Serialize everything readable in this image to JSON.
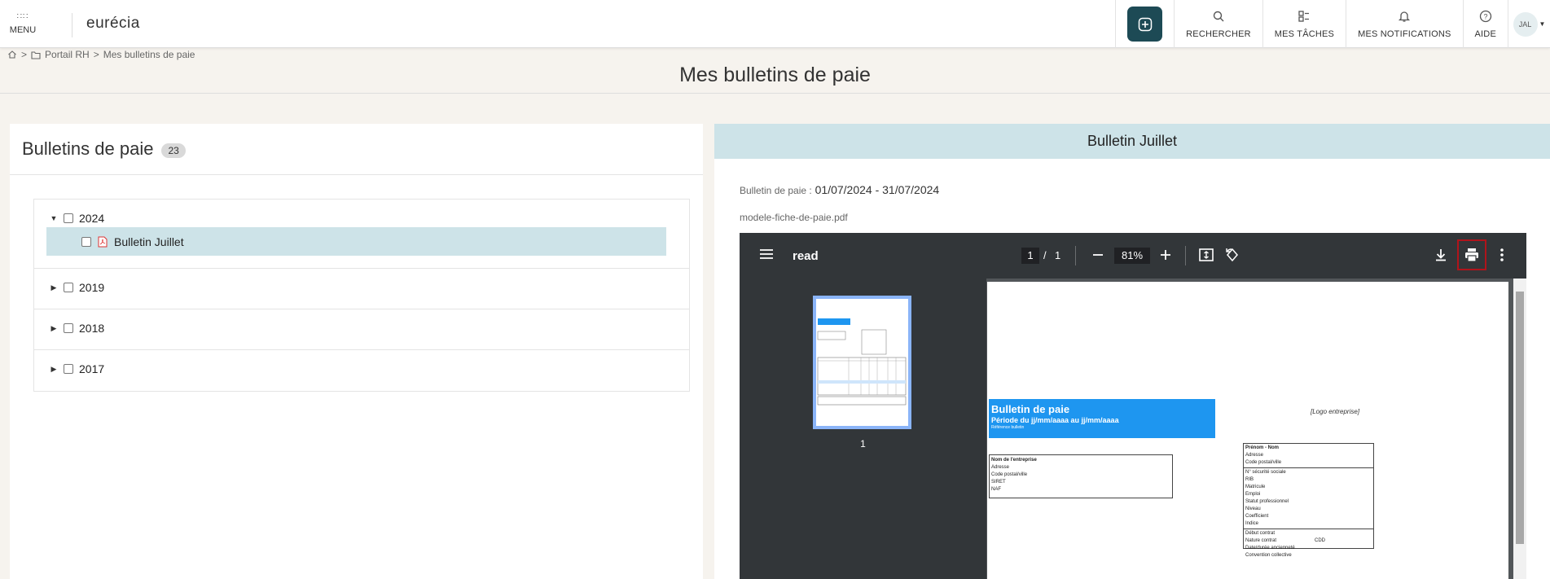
{
  "topbar": {
    "menu_label": "MENU",
    "brand": "eurécia",
    "nav": [
      {
        "label": "RECHERCHER",
        "icon": "search-icon"
      },
      {
        "label": "MES TÂCHES",
        "icon": "tasks-icon"
      },
      {
        "label": "MES NOTIFICATIONS",
        "icon": "bell-icon"
      },
      {
        "label": "AIDE",
        "icon": "help-icon"
      }
    ],
    "avatar": "JAL"
  },
  "breadcrumb": {
    "sep1": ">",
    "portal": "Portail RH",
    "sep2": ">",
    "current": "Mes bulletins de paie"
  },
  "page_title": "Mes bulletins de paie",
  "left": {
    "title": "Bulletins de paie",
    "count": "23",
    "years": [
      {
        "label": "2024",
        "expanded": true,
        "items": [
          "Bulletin Juillet"
        ]
      },
      {
        "label": "2019",
        "expanded": false
      },
      {
        "label": "2018",
        "expanded": false
      },
      {
        "label": "2017",
        "expanded": false
      }
    ]
  },
  "right": {
    "title": "Bulletin Juillet",
    "period_key": "Bulletin de paie :",
    "period_value": "01/07/2024 - 31/07/2024",
    "file_name": "modele-fiche-de-paie.pdf"
  },
  "pdf": {
    "title": "read",
    "page_current": "1",
    "page_sep": "/",
    "page_total": "1",
    "zoom": "81%",
    "thumb_label": "1",
    "doc": {
      "banner_title": "Bulletin de paie",
      "banner_sub": "Période du jj/mm/aaaa au jj/mm/aaaa",
      "banner_ref": "Référence bulletin",
      "logo": "[Logo entreprise]",
      "ent_header": "Nom de l'entreprise",
      "ent_lines": [
        "Adresse",
        "Code postal/ville",
        "SIRET",
        "NAF"
      ],
      "emp_header": "Prénom - Nom",
      "emp_lines1": [
        "Adresse",
        "Code postal/ville"
      ],
      "emp_lines2": [
        "N° sécurité sociale",
        "RIB",
        "Matricule",
        "Emploi",
        "Statut professionnel",
        "Niveau",
        "Coefficient",
        "Indice"
      ],
      "emp_lines3": [
        "Début contrat",
        "Nature contrat",
        "Date/durée ancienneté",
        "Convention collective"
      ],
      "contract_type": "CDD"
    }
  },
  "colors": {
    "accent": "#1d4a55",
    "highlight": "#cde3e8",
    "banner": "#1e96f0",
    "print_outline": "#b0141b"
  }
}
